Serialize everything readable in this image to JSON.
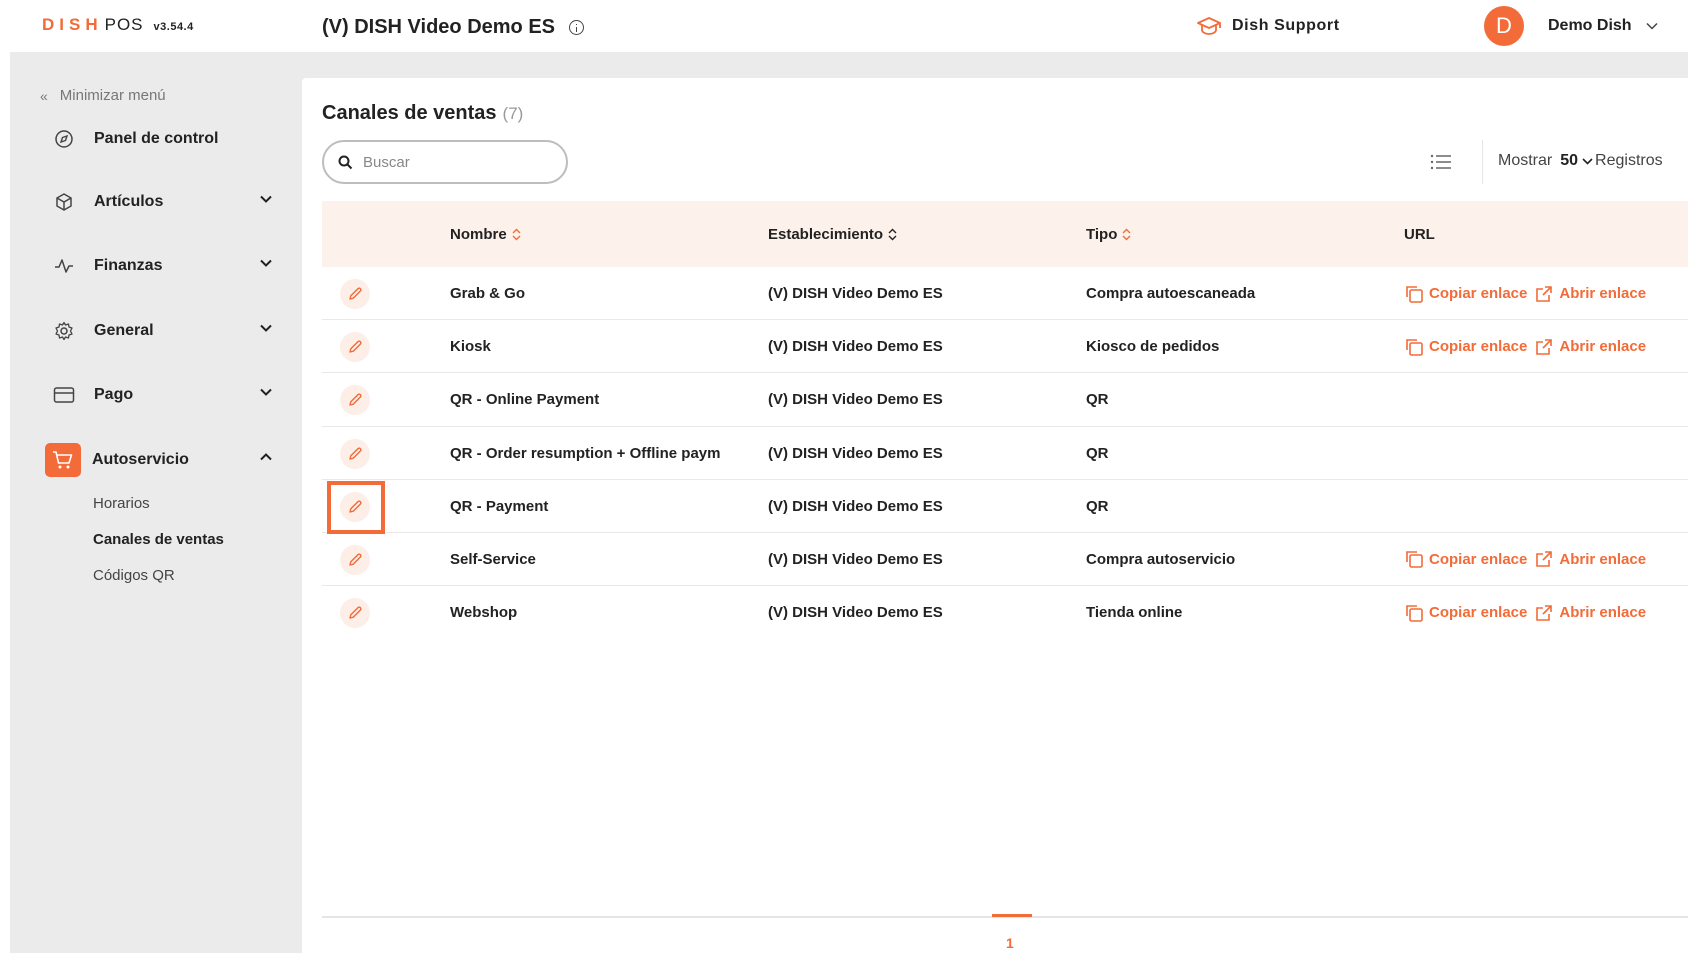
{
  "header": {
    "logo_brand": "DISH",
    "logo_product": "POS",
    "version": "v3.54.4",
    "venue_name": "(V) DISH Video Demo ES",
    "support_label": "Dish Support",
    "avatar_initial": "D",
    "user_name": "Demo Dish"
  },
  "sidebar": {
    "minimize_label": "Minimizar menú",
    "items": [
      {
        "label": "Panel de control",
        "icon": "compass-icon"
      },
      {
        "label": "Artículos",
        "icon": "box-icon"
      },
      {
        "label": "Finanzas",
        "icon": "pulse-icon"
      },
      {
        "label": "General",
        "icon": "gear-icon"
      },
      {
        "label": "Pago",
        "icon": "card-icon"
      },
      {
        "label": "Autoservicio",
        "icon": "cart-icon"
      }
    ],
    "subitems": [
      "Horarios",
      "Canales de ventas",
      "Códigos QR"
    ]
  },
  "main": {
    "title": "Canales de ventas",
    "count": "(7)",
    "search_placeholder": "Buscar",
    "show_label": "Mostrar",
    "show_value": "50",
    "records_label": "Registros",
    "columns": [
      "Nombre",
      "Establecimiento",
      "Tipo",
      "URL"
    ],
    "copy_label": "Copiar enlace",
    "open_label": "Abrir enlace",
    "rows": [
      {
        "name": "Grab & Go",
        "venue": "(V) DISH Video Demo ES",
        "type": "Compra autoescaneada",
        "has_url": true
      },
      {
        "name": "Kiosk",
        "venue": "(V) DISH Video Demo ES",
        "type": "Kiosco de pedidos",
        "has_url": true
      },
      {
        "name": "QR - Online Payment",
        "venue": "(V) DISH Video Demo ES",
        "type": "QR",
        "has_url": false
      },
      {
        "name": "QR - Order resumption + Offline paym",
        "venue": "(V) DISH Video Demo ES",
        "type": "QR",
        "has_url": false
      },
      {
        "name": "QR - Payment",
        "venue": "(V) DISH Video Demo ES",
        "type": "QR",
        "has_url": false
      },
      {
        "name": "Self-Service",
        "venue": "(V) DISH Video Demo ES",
        "type": "Compra autoservicio",
        "has_url": true
      },
      {
        "name": "Webshop",
        "venue": "(V) DISH Video Demo ES",
        "type": "Tienda online",
        "has_url": true
      }
    ],
    "pagination": {
      "current": "1"
    }
  },
  "colors": {
    "accent": "#f26b38",
    "shell": "#ebebeb",
    "header_row": "#fdf1ec"
  }
}
